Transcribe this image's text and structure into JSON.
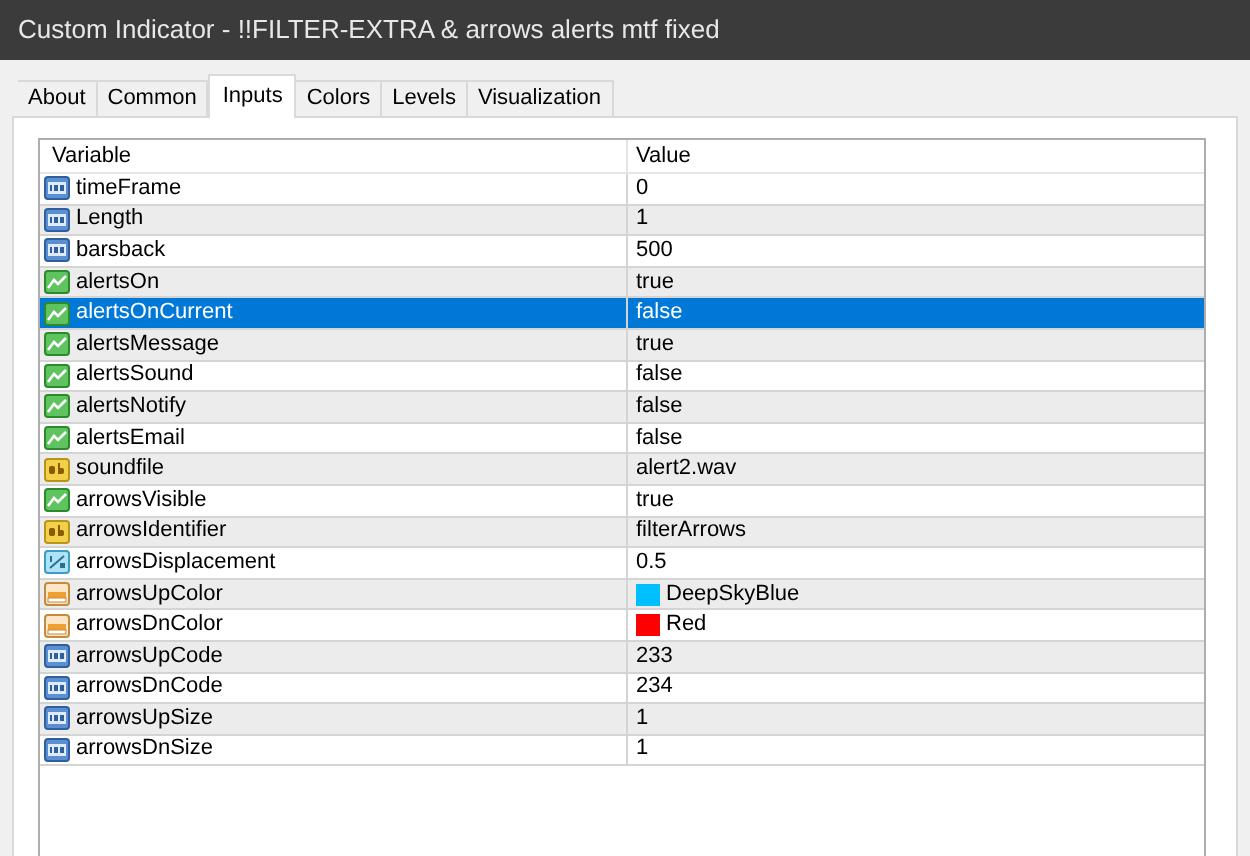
{
  "window": {
    "title": "Custom Indicator - !!FILTER-EXTRA & arrows alerts mtf fixed"
  },
  "tabs": [
    {
      "label": "About",
      "selected": false
    },
    {
      "label": "Common",
      "selected": false
    },
    {
      "label": "Inputs",
      "selected": true
    },
    {
      "label": "Colors",
      "selected": false
    },
    {
      "label": "Levels",
      "selected": false
    },
    {
      "label": "Visualization",
      "selected": false
    }
  ],
  "table": {
    "columns": [
      "Variable",
      "Value"
    ],
    "rows": [
      {
        "kind": "int",
        "variable": "timeFrame",
        "value": "0",
        "selected": false
      },
      {
        "kind": "int",
        "variable": "Length",
        "value": "1",
        "selected": false
      },
      {
        "kind": "int",
        "variable": "barsback",
        "value": "500",
        "selected": false
      },
      {
        "kind": "bool",
        "variable": "alertsOn",
        "value": "true",
        "selected": false
      },
      {
        "kind": "bool",
        "variable": "alertsOnCurrent",
        "value": "false",
        "selected": true
      },
      {
        "kind": "bool",
        "variable": "alertsMessage",
        "value": "true",
        "selected": false
      },
      {
        "kind": "bool",
        "variable": "alertsSound",
        "value": "false",
        "selected": false
      },
      {
        "kind": "bool",
        "variable": "alertsNotify",
        "value": "false",
        "selected": false
      },
      {
        "kind": "bool",
        "variable": "alertsEmail",
        "value": "false",
        "selected": false
      },
      {
        "kind": "string",
        "variable": "soundfile",
        "value": "alert2.wav",
        "selected": false
      },
      {
        "kind": "bool",
        "variable": "arrowsVisible",
        "value": "true",
        "selected": false
      },
      {
        "kind": "string",
        "variable": "arrowsIdentifier",
        "value": "filterArrows",
        "selected": false
      },
      {
        "kind": "double",
        "variable": "arrowsDisplacement",
        "value": "0.5",
        "selected": false
      },
      {
        "kind": "color",
        "variable": "arrowsUpColor",
        "value": "DeepSkyBlue",
        "color": "#00bfff",
        "selected": false
      },
      {
        "kind": "color",
        "variable": "arrowsDnColor",
        "value": "Red",
        "color": "#ff0000",
        "selected": false
      },
      {
        "kind": "int",
        "variable": "arrowsUpCode",
        "value": "233",
        "selected": false
      },
      {
        "kind": "int",
        "variable": "arrowsDnCode",
        "value": "234",
        "selected": false
      },
      {
        "kind": "int",
        "variable": "arrowsUpSize",
        "value": "1",
        "selected": false
      },
      {
        "kind": "int",
        "variable": "arrowsDnSize",
        "value": "1",
        "selected": false
      }
    ]
  }
}
